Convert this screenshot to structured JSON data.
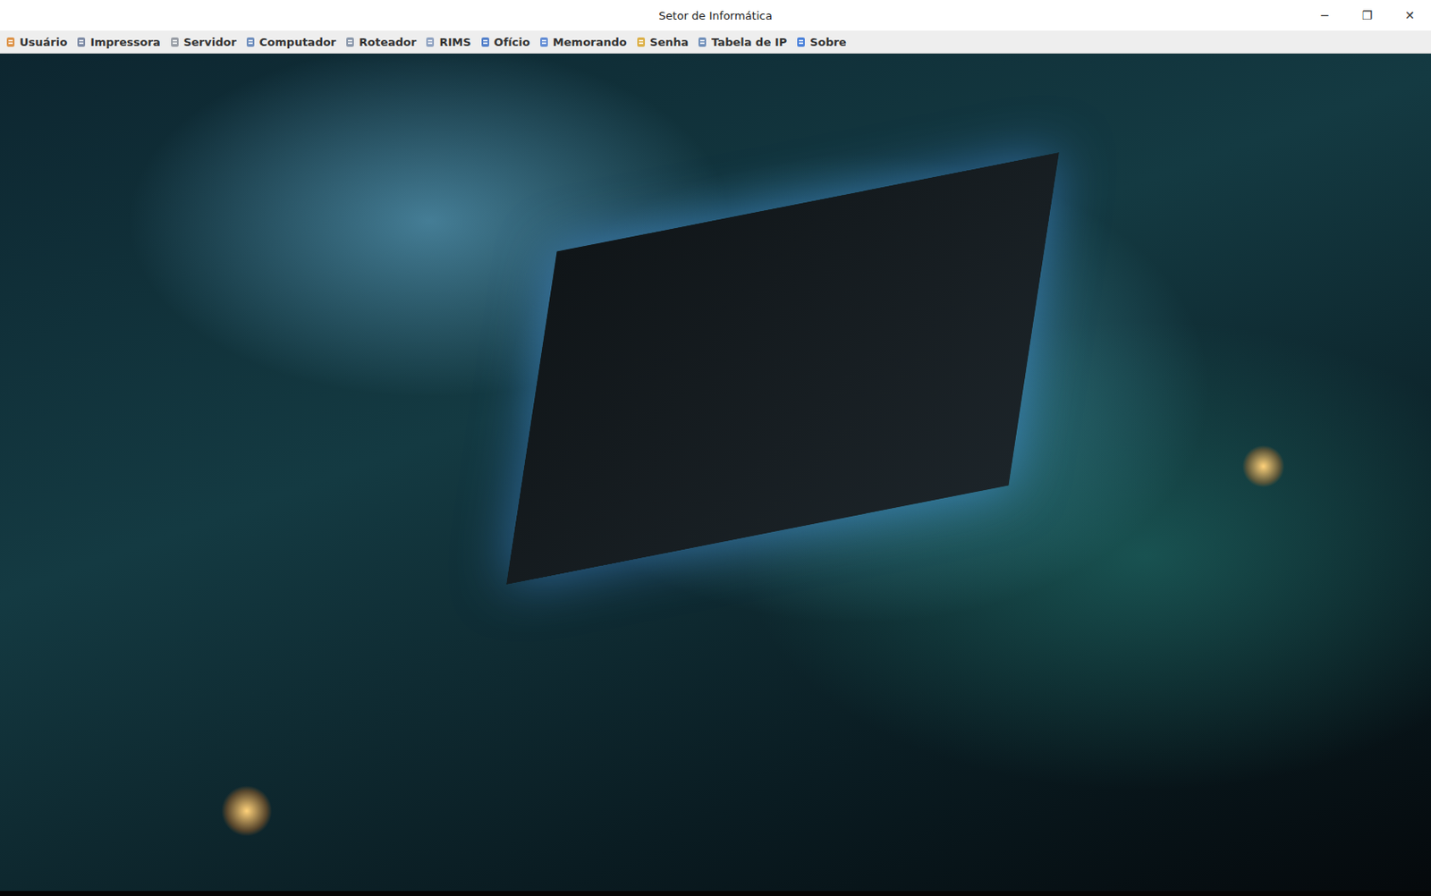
{
  "window": {
    "title": "Setor de Informática",
    "controls": [
      "─",
      "❐",
      "✕"
    ]
  },
  "menu": [
    {
      "label": "Usuário"
    },
    {
      "label": "Impressora"
    },
    {
      "label": "Servidor"
    },
    {
      "label": "Computador"
    },
    {
      "label": "Roteador"
    },
    {
      "label": "RIMS"
    },
    {
      "label": "Ofício"
    },
    {
      "label": "Memorando"
    },
    {
      "label": "Senha"
    },
    {
      "label": "Tabela de IP"
    },
    {
      "label": "Sobre"
    }
  ]
}
